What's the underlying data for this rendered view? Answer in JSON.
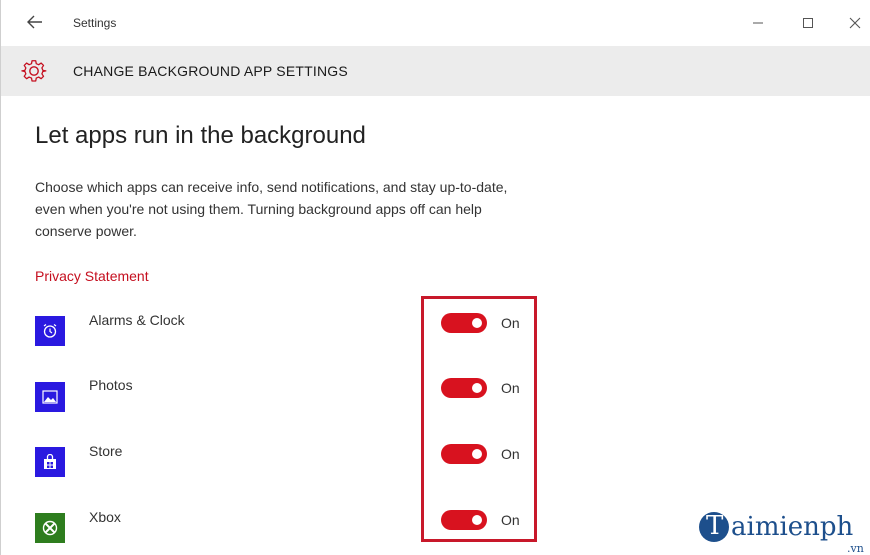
{
  "window": {
    "title": "Settings",
    "controls": {
      "minimize": "—",
      "maximize": "☐",
      "close": "✕"
    }
  },
  "header": {
    "title": "CHANGE BACKGROUND APP SETTINGS",
    "icon": "gear-icon",
    "accent": "#c50f1f"
  },
  "main": {
    "title": "Let apps run in the background",
    "description": "Choose which apps can receive info, send notifications, and stay up-to-date, even when you're not using them. Turning background apps off can help conserve power.",
    "privacy_link": "Privacy Statement",
    "apps": [
      {
        "name": "Alarms & Clock",
        "icon": "alarm-clock-icon",
        "tile_color": "#2a19e0",
        "state": "On",
        "enabled": true
      },
      {
        "name": "Photos",
        "icon": "photos-icon",
        "tile_color": "#2a19e0",
        "state": "On",
        "enabled": true
      },
      {
        "name": "Store",
        "icon": "store-icon",
        "tile_color": "#2a19e0",
        "state": "On",
        "enabled": true
      },
      {
        "name": "Xbox",
        "icon": "xbox-icon",
        "tile_color": "#2e7d1e",
        "state": "On",
        "enabled": true
      }
    ]
  },
  "watermark": {
    "logo_letter": "T",
    "text": "aimienph",
    "suffix": ".vn"
  },
  "colors": {
    "toggle_on": "#d8121f",
    "highlight_box": "#c8182a",
    "header_band": "#ececec"
  }
}
